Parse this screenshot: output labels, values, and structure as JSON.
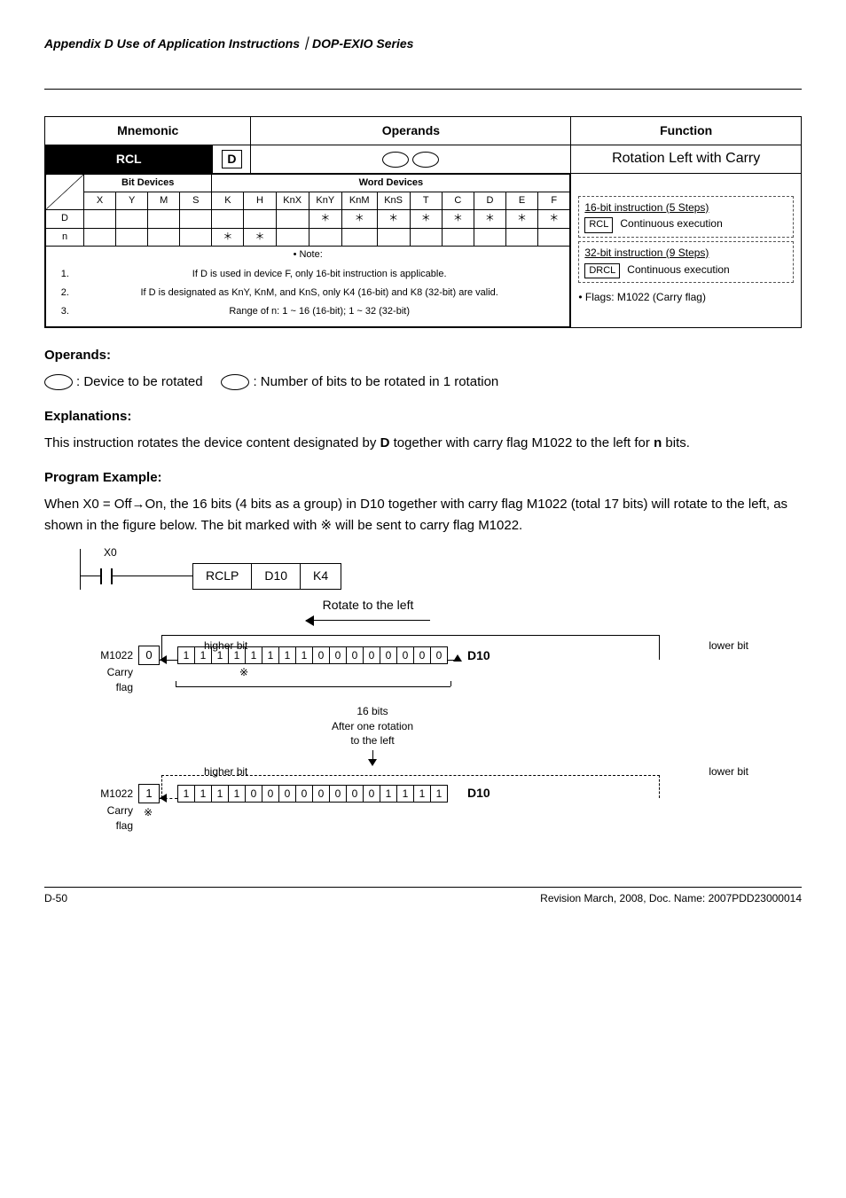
{
  "header": {
    "title": "Appendix D Use of Application Instructions｜DOP-EXIO Series"
  },
  "table": {
    "col_mnemonic": "Mnemonic",
    "col_operands": "Operands",
    "col_function": "Function",
    "mnemonic_black": "RCL",
    "mnemonic_box": "D",
    "function_text": "Rotation Left with Carry",
    "bit_devices_hdr": "Bit Devices",
    "word_devices_hdr": "Word Devices",
    "cols": [
      "X",
      "Y",
      "M",
      "S",
      "K",
      "H",
      "KnX",
      "KnY",
      "KnM",
      "KnS",
      "T",
      "C",
      "D",
      "E",
      "F"
    ],
    "row_d_label": "D",
    "row_n_label": "n",
    "row_d": [
      "",
      "",
      "",
      "",
      "",
      "",
      "",
      "＊",
      "＊",
      "＊",
      "＊",
      "＊",
      "＊",
      "＊",
      "＊"
    ],
    "row_n": [
      "",
      "",
      "",
      "",
      "＊",
      "＊",
      "",
      "",
      "",
      "",
      "",
      "",
      "",
      "",
      ""
    ],
    "note_bullet": "Note:",
    "notes": [
      "If D is used in device F, only 16-bit instruction is applicable.",
      "If D is designated as KnY, KnM, and KnS, only K4 (16-bit) and K8 (32-bit) are valid.",
      "Range of n: 1 ~ 16 (16-bit); 1 ~ 32 (32-bit)"
    ],
    "steps16_title": "16-bit instruction (5 Steps)",
    "steps16_lbl": "RCL",
    "steps16_txt": "Continuous execution",
    "steps32_title": "32-bit instruction (9 Steps)",
    "steps32_lbl": "DRCL",
    "steps32_txt": "Continuous execution",
    "flags_bullet": "Flags: M1022 (Carry flag)"
  },
  "operands": {
    "heading": "Operands:",
    "d_label": ": Device to be rotated",
    "n_label": ": Number of bits to be rotated in 1 rotation"
  },
  "explanations": {
    "heading": "Explanations:",
    "text_pre": "This instruction rotates the device content designated by ",
    "text_bold": "D",
    "text_mid": " together with carry flag M1022 to the left for ",
    "text_bold2": "n",
    "text_post": " bits."
  },
  "example": {
    "heading": "Program Example:",
    "para": "When X0 = Off→On, the 16 bits (4 bits as a group) in D10 together with carry flag M1022 (total 17 bits) will rotate to the left, as shown in the figure below. The bit marked with ※ will be sent to carry flag M1022."
  },
  "diagram": {
    "x0": "X0",
    "instr": [
      "RCLP",
      "D10",
      "K4"
    ],
    "rotate_left": "Rotate to the left",
    "higher_bit": "higher bit",
    "lower_bit": "lower bit",
    "m1022": "M1022",
    "carry": "Carry",
    "flag": "flag",
    "carry_val_top": "0",
    "carry_val_bot": "1",
    "star": "※",
    "bits_top": [
      "1",
      "1",
      "1",
      "1",
      "1",
      "1",
      "1",
      "1",
      "0",
      "0",
      "0",
      "0",
      "0",
      "0",
      "0",
      "0"
    ],
    "bits_bot": [
      "1",
      "1",
      "1",
      "1",
      "0",
      "0",
      "0",
      "0",
      "0",
      "0",
      "0",
      "0",
      "1",
      "1",
      "1",
      "1"
    ],
    "d10": "D10",
    "sixteen_bits": "16 bits",
    "after_rot1": "After one rotation",
    "after_rot2": "to the left"
  },
  "footer": {
    "left": "D-50",
    "right": "Revision March, 2008, Doc. Name: 2007PDD23000014"
  }
}
